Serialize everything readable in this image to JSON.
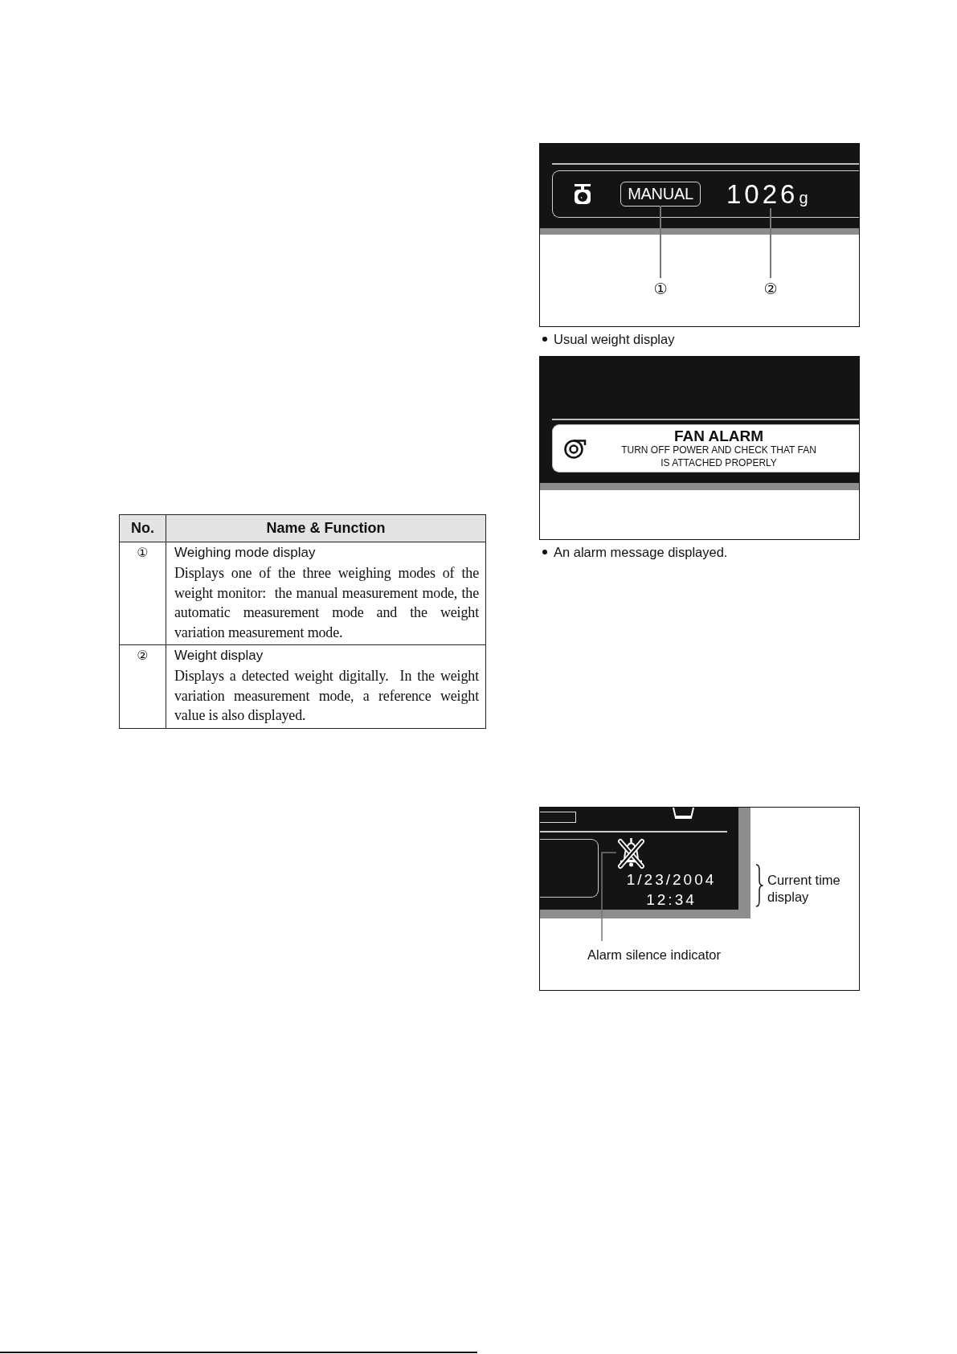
{
  "figures": [
    {
      "kind": "weight",
      "screen": {
        "mode": "MANUAL",
        "weight": "1026",
        "unit": "g"
      },
      "callouts": [
        "①",
        "②"
      ],
      "caption": "Usual weight display"
    },
    {
      "kind": "alarm",
      "alarm": {
        "title": "FAN ALARM",
        "message": "TURN OFF POWER AND CHECK THAT FAN IS ATTACHED PROPERLY"
      },
      "caption": "An alarm message displayed."
    },
    {
      "kind": "clock",
      "screen": {
        "date": "1/23/2004",
        "time": "12:34"
      },
      "bracket_label": "Current time display",
      "pointer_label": "Alarm silence indicator"
    }
  ],
  "table": {
    "columns": [
      "No.",
      "Name & Function"
    ],
    "rows": [
      {
        "no": "①",
        "name": "Weighing mode display",
        "description": "Displays one of the three weighing modes of the weight monitor:  the manual measurement mode, the automatic measurement mode and the weight variation measurement mode."
      },
      {
        "no": "②",
        "name": "Weight display",
        "description": "Displays a detected weight digitally.  In the weight variation measurement mode, a reference weight value is also displayed."
      }
    ]
  }
}
